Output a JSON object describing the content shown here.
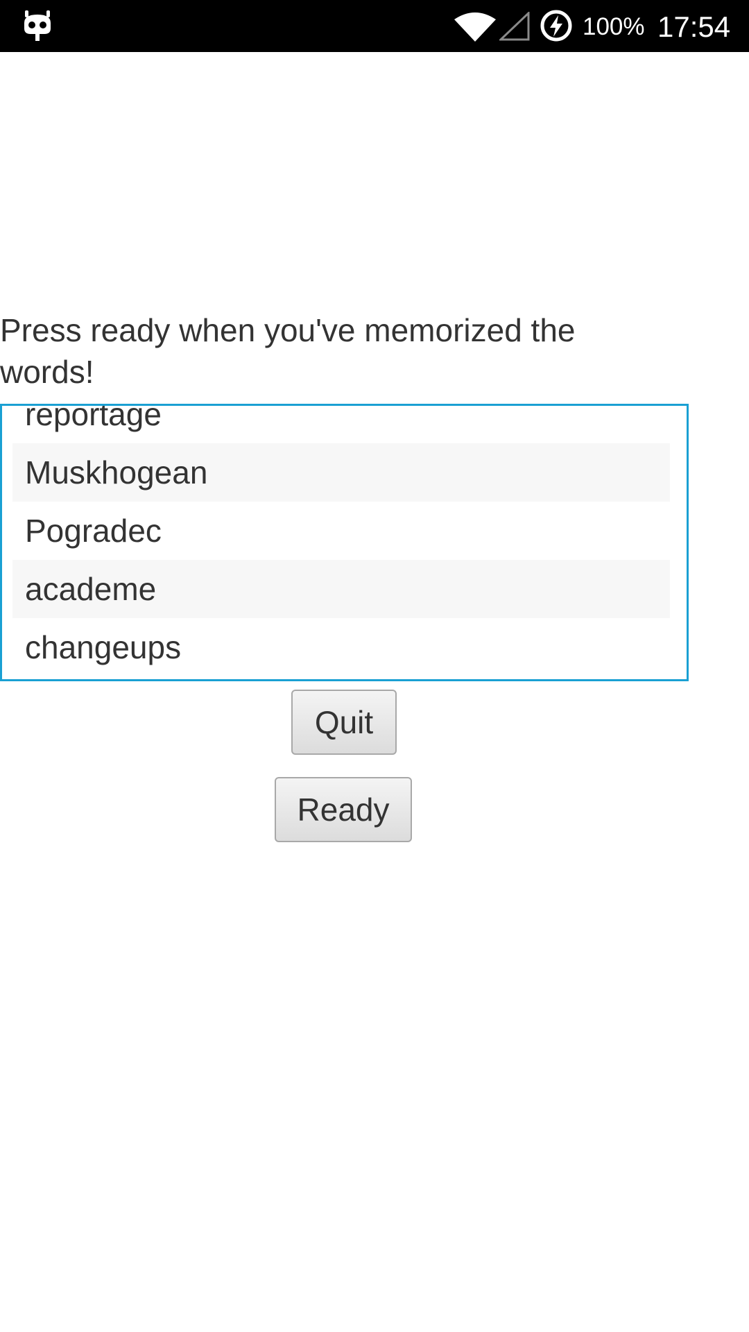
{
  "status_bar": {
    "battery_percent": "100%",
    "time": "17:54",
    "icons": [
      "android-debug-icon",
      "wifi-icon",
      "cell-signal-icon",
      "battery-charging-icon"
    ]
  },
  "prompt": {
    "text": "Press ready when you've memorized the words!"
  },
  "word_list": {
    "items": [
      {
        "label": "reportage"
      },
      {
        "label": "Muskhogean"
      },
      {
        "label": "Pogradec"
      },
      {
        "label": "academe"
      },
      {
        "label": "changeups"
      }
    ]
  },
  "buttons": {
    "quit_label": "Quit",
    "ready_label": "Ready"
  },
  "colors": {
    "list_border": "#1aa0d3",
    "status_bar_bg": "#000000",
    "alt_row_bg": "#f7f7f7"
  }
}
